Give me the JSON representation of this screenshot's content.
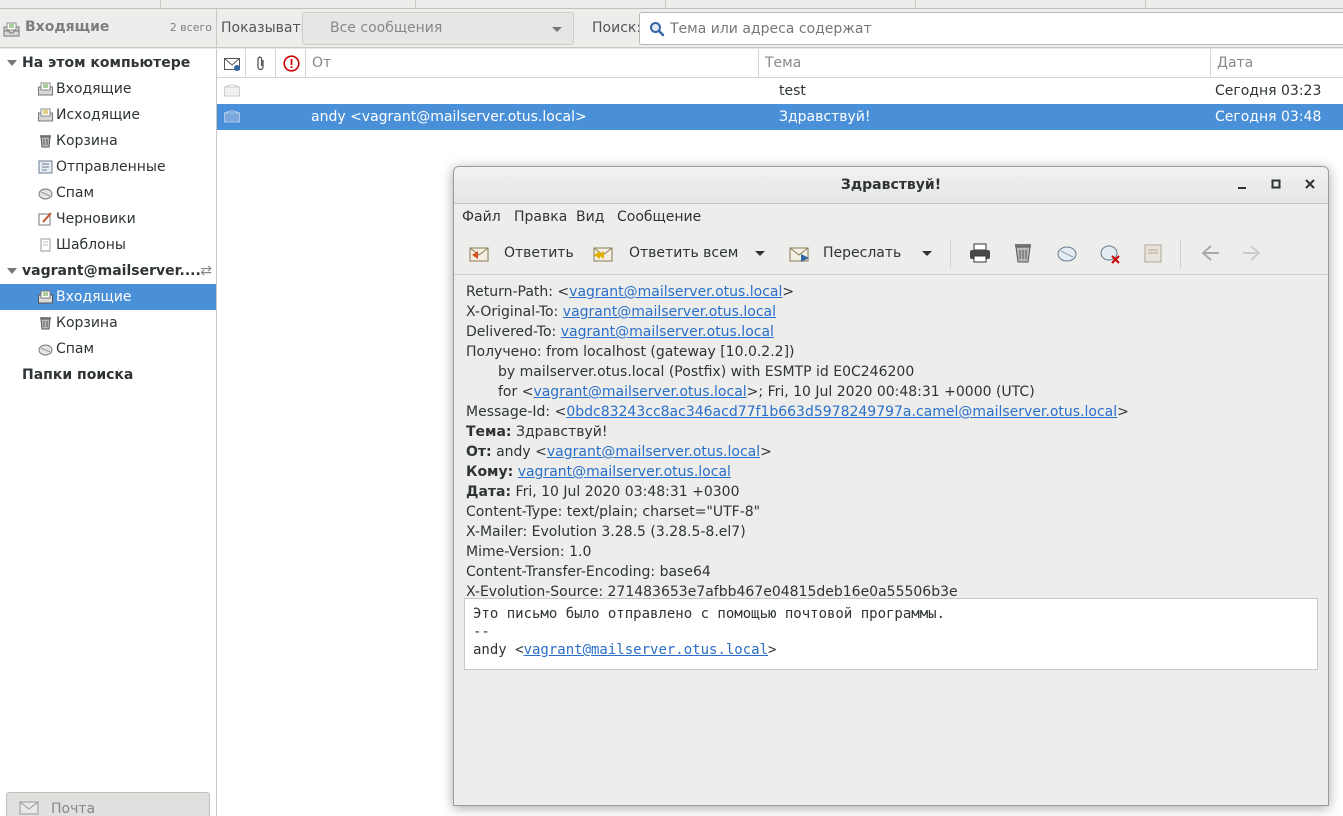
{
  "folder_header": {
    "title": "Входящие",
    "count": "2 всего"
  },
  "filter": {
    "show_label": "Показывать:",
    "show_value": "Все сообщения",
    "search_label": "Поиск:",
    "search_placeholder": "Тема или адреса содержат"
  },
  "sidebar": {
    "local_account": "На этом компьютере",
    "local_folders": [
      {
        "label": "Входящие",
        "icon": "inbox-icon"
      },
      {
        "label": "Исходящие",
        "icon": "outbox-icon"
      },
      {
        "label": "Корзина",
        "icon": "trash-icon"
      },
      {
        "label": "Отправленные",
        "icon": "sent-icon"
      },
      {
        "label": "Спам",
        "icon": "spam-icon"
      },
      {
        "label": "Черновики",
        "icon": "drafts-icon"
      },
      {
        "label": "Шаблоны",
        "icon": "templates-icon"
      }
    ],
    "remote_account": "vagrant@mailserver....",
    "remote_folders": [
      {
        "label": "Входящие",
        "icon": "inbox-icon",
        "selected": true
      },
      {
        "label": "Корзина",
        "icon": "trash-icon"
      },
      {
        "label": "Спам",
        "icon": "spam-icon"
      }
    ],
    "search_folders": "Папки поиска",
    "switcher_label": "Почта"
  },
  "columns": {
    "from": "От",
    "subject": "Тема",
    "date": "Дата"
  },
  "messages": [
    {
      "from": "",
      "subject": "test",
      "date": "Сегодня 03:23",
      "selected": false
    },
    {
      "from": "andy <vagrant@mailserver.otus.local>",
      "subject": "Здравствуй!",
      "date": "Сегодня 03:48",
      "selected": true
    }
  ],
  "window": {
    "title": "Здравствуй!",
    "menu": [
      "Файл",
      "Правка",
      "Вид",
      "Сообщение"
    ],
    "toolbar": {
      "reply": "Ответить",
      "reply_all": "Ответить всем",
      "forward": "Переслать"
    }
  },
  "headers": {
    "return_path_label": "Return-Path: <",
    "return_path": "vagrant@mailserver.otus.local",
    "original_to_label": "X-Original-To: ",
    "original_to": "vagrant@mailserver.otus.local",
    "delivered_to_label": "Delivered-To: ",
    "delivered_to": "vagrant@mailserver.otus.local",
    "received_line1": "Получено: from localhost (gateway [10.0.2.2])",
    "received_line2": "by mailserver.otus.local (Postfix) with ESMTP id E0C246200",
    "received_line3_pre": "for <",
    "received_line3_addr": "vagrant@mailserver.otus.local",
    "received_line3_post": ">; Fri, 10 Jul 2020 00:48:31 +0000 (UTC)",
    "message_id_label": "Message-Id: <",
    "message_id": "0bdc83243cc8ac346acd77f1b663d5978249797a.camel@mailserver.otus.local",
    "subject_label": "Тема:",
    "subject": " Здравствуй!",
    "from_label": "От:",
    "from_name": " andy <",
    "from_addr": "vagrant@mailserver.otus.local",
    "to_label": "Кому:",
    "to_addr": "vagrant@mailserver.otus.local",
    "date_label": "Дата:",
    "date": " Fri, 10 Jul 2020 03:48:31 +0300",
    "content_type": "Content-Type: text/plain; charset=\"UTF-8\"",
    "x_mailer": "X-Mailer: Evolution 3.28.5 (3.28.5-8.el7)",
    "mime_version": "Mime-Version: 1.0",
    "encoding": "Content-Transfer-Encoding: base64",
    "evolution_source": "X-Evolution-Source: 271483653e7afbb467e04815deb16e0a55506b3e"
  },
  "body": {
    "line1": "Это письмо было отправлено с помощью почтовой программы.",
    "line2": "--",
    "sig_name": "andy <",
    "sig_addr": "vagrant@mailserver.otus.local",
    "sig_end": ">"
  }
}
